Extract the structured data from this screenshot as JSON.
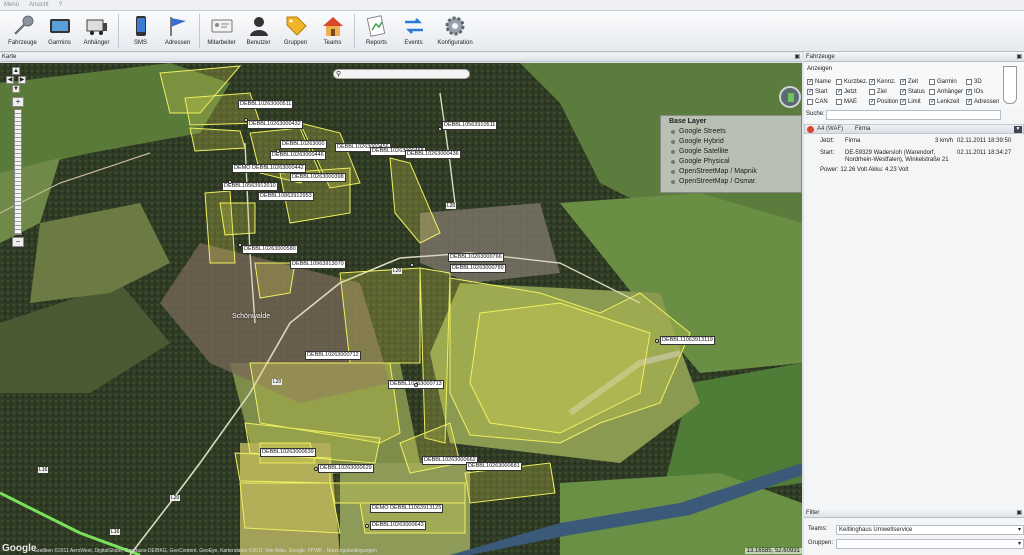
{
  "menu": [
    "Menü",
    "Ansicht",
    "?"
  ],
  "toolbar": [
    {
      "label": "Fahrzeuge",
      "icon": "wrench-icon"
    },
    {
      "label": "Garmins",
      "icon": "garmin-icon"
    },
    {
      "label": "Anhänger",
      "icon": "trailer-icon"
    },
    {
      "label": "SMS",
      "icon": "phone-icon"
    },
    {
      "label": "Adressen",
      "icon": "flag-icon"
    },
    {
      "label": "Mitarbeiter",
      "icon": "id-card-icon"
    },
    {
      "label": "Benutzer",
      "icon": "user-icon"
    },
    {
      "label": "Gruppen",
      "icon": "tag-icon"
    },
    {
      "label": "Teams",
      "icon": "house-icon"
    },
    {
      "label": "Reports",
      "icon": "report-icon"
    },
    {
      "label": "Events",
      "icon": "events-icon"
    },
    {
      "label": "Konfiguration",
      "icon": "gear-icon"
    }
  ],
  "map": {
    "panel_title": "Karte",
    "layers": {
      "title": "Base Layer",
      "items": [
        "Google Streets",
        "Google Hybrid",
        "Google Satellite",
        "Google Physical",
        "OpenStreetMap / Mapnik",
        "OpenStreetMap / Osmar."
      ]
    },
    "town": "Schönwalde",
    "roads": [
      "L20",
      "L20",
      "L20",
      "L16",
      "L16",
      "L20"
    ],
    "vehicles": [
      "DEBBL10263000511",
      "DEBBL10263000432",
      "DEBBL10263000",
      "DEBBL10263000456",
      "DEBBL10263000446",
      "DEBBL10263000458",
      "DEBBL10263000436",
      "DEMO DEBBL10263000442",
      "DEBBL10263000398",
      "DEBBL10563912010",
      "DEBBL10863912953",
      "DEBBL10563910511",
      "DEBBL10263000580",
      "DEBBL10963913070",
      "DEBBL10263000766",
      "DEBBL10263000789",
      "DEBBL11063913119",
      "DEBBL10263000712",
      "DEBBL10263000713",
      "DEBBL10263000639",
      "DEBBL10263000629",
      "DEBBL10263000662",
      "DEBBL10263000681",
      "DEMO DEBBL11063913125",
      "DEBBL10263000643"
    ],
    "copyright": "Grafiken ©2011 AeroWest, DigitalGlobe, GeoBasis-DE/BKG, GeoContent, GeoEye, Kartendaten ©2011 Tele Atlas, Google, PPWK - Nutzungsbedingungen",
    "logo": "Google",
    "coords": "13.16585, 52.60931"
  },
  "side": {
    "panel_title": "Fahrzeuge",
    "anzeigen_title": "Anzeigen",
    "options": [
      {
        "label": "Name",
        "on": true
      },
      {
        "label": "Kurzbez.",
        "on": false
      },
      {
        "label": "Kennz.",
        "on": true
      },
      {
        "label": "Zeit",
        "on": true
      },
      {
        "label": "Garmin",
        "on": false
      },
      {
        "label": "3D",
        "on": false
      },
      {
        "label": "Start",
        "on": true
      },
      {
        "label": "Jetzt",
        "on": true
      },
      {
        "label": "Ziel",
        "on": false
      },
      {
        "label": "Status",
        "on": true
      },
      {
        "label": "Anhänger",
        "on": false
      },
      {
        "label": "IOs",
        "on": true
      },
      {
        "label": "CAN",
        "on": false
      },
      {
        "label": "MAE",
        "on": false
      },
      {
        "label": "Position",
        "on": true
      },
      {
        "label": "Limit",
        "on": true
      },
      {
        "label": "Lenkzeit",
        "on": true
      },
      {
        "label": "Adressen",
        "on": true
      }
    ],
    "search_label": "Suche:",
    "vehicle": {
      "name": "A4 (WAF)",
      "group": "Firma",
      "jetzt_label": "Jetzt:",
      "jetzt_value": "Firma",
      "speed": "3 km/h",
      "jetzt_time": "02.11.2011 18:39:50",
      "start_label": "Start:",
      "start_address1": "DE-59329 Wadersloh (Warendorf,",
      "start_address2": "Nordrhein-Westfalen), Winkelstraße 21",
      "start_time": "02.11.2011 18:34:27",
      "power": "Power:  12.26 Volt   Akku:  4.23 Volt"
    },
    "filter": {
      "title": "Filter",
      "teams_label": "Teams:",
      "teams_value": "Keitlinghaus Umweltservice",
      "gruppen_label": "Gruppen:",
      "gruppen_value": ""
    }
  }
}
